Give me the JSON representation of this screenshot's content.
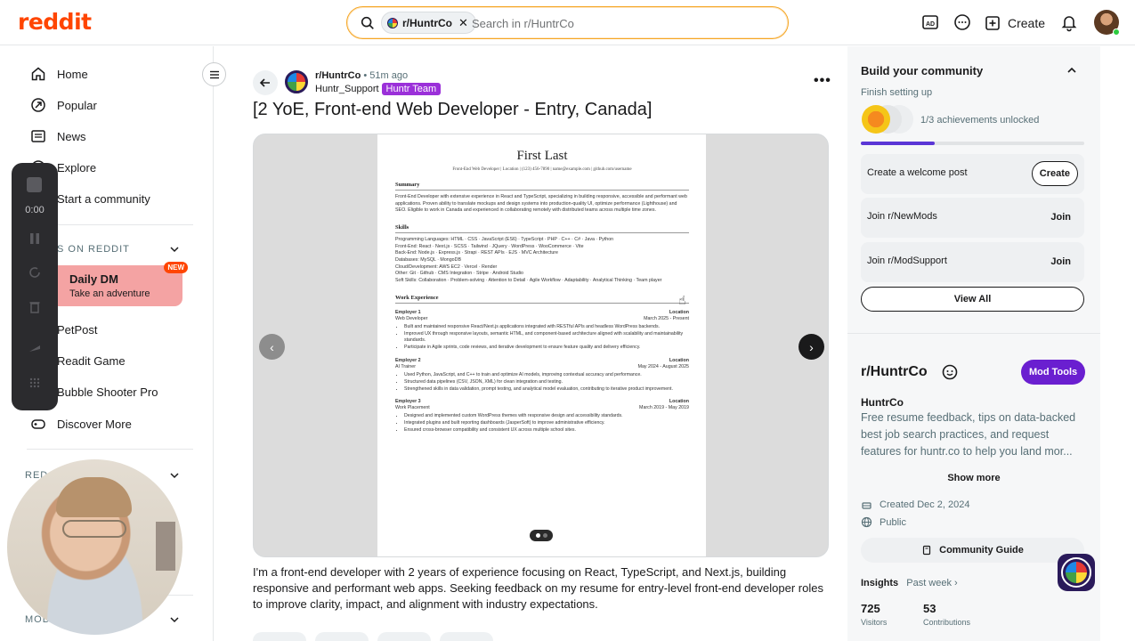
{
  "header": {
    "logo": "reddit",
    "search_chip": "r/HuntrCo",
    "search_placeholder": "Search in r/HuntrCo",
    "create_label": "Create"
  },
  "sidebar": {
    "nav": [
      {
        "label": "Home",
        "icon": "home-icon"
      },
      {
        "label": "Popular",
        "icon": "popular-icon"
      },
      {
        "label": "News",
        "icon": "news-icon"
      },
      {
        "label": "Explore",
        "icon": "explore-icon"
      },
      {
        "label": "Start a community",
        "icon": "plus-icon"
      }
    ],
    "games_label": "S ON REDDIT",
    "daily": {
      "title": "Daily DM",
      "subtitle": "Take an adventure",
      "badge": "NEW"
    },
    "games": [
      "PetPost",
      "Readit Game",
      "Bubble Shooter Pro"
    ],
    "discover": "Discover More",
    "recent_label": "RED",
    "mod_label": "MOD"
  },
  "recorder": {
    "time": "0:00"
  },
  "post": {
    "subreddit": "r/HuntrCo",
    "time_ago": "• 51m ago",
    "author": "Huntr_Support",
    "flair": "Huntr Team",
    "title": "[2 YoE, Front-end Web Developer - Entry, Canada]",
    "body": "I'm a front-end developer with 2 years of experience focusing on React, TypeScript, and Next.js, building responsive and performant web apps. Seeking feedback on my resume for entry-level front-end developer roles to improve clarity, impact, and alignment with industry expectations.",
    "resume": {
      "name": "First Last",
      "contact": "Front-End Web Developer | Location | (123) 456-7890 | name@example.com | github.com/username",
      "summary_h": "Summary",
      "summary": "Front-End Developer with extensive experience in React and TypeScript, specializing in building responsive, accessible and performant web applications. Proven ability to translate mockups and design systems into production-quality UI, optimize performance (Lighthouse) and SEO. Eligible to work in Canada and experienced in collaborating remotely with distributed teams across multiple time zones.",
      "skills_h": "Skills",
      "skills": [
        "Programming Languages: HTML · CSS · JavaScript (ES6) · TypeScript · PHP · C++ · C# · Java · Python",
        "Front-End: React · Next.js · SCSS · Tailwind · JQuery · WordPress · WooCommerce · Vite",
        "Back-End: Node.js · Express.js · Strapi · REST APIs · EJS · MVC Architecture",
        "Databases: MySQL · MongoDB",
        "Cloud/Development: AWS EC2 · Vercel · Render",
        "Other: Git · Github · CMS Integration · Stripe · Android Studio",
        "Soft Skills: Collaboration · Problem-solving · Attention to Detail · Agile Workflow · Adaptability · Analytical Thinking · Team player"
      ],
      "work_h": "Work Experience",
      "jobs": [
        {
          "employer": "Employer 1",
          "loc": "Location",
          "role": "Web Developer",
          "dates": "March 2025 - Present",
          "bullets": [
            "Built and maintained responsive React/Next.js applications integrated with RESTful APIs and headless WordPress backends.",
            "Improved UX through responsive layouts, semantic HTML, and component-based architecture aligned with scalability and maintainability standards.",
            "Participate in Agile sprints, code reviews, and iterative development to ensure feature quality and delivery efficiency."
          ]
        },
        {
          "employer": "Employer 2",
          "loc": "Location",
          "role": "AI Trainer",
          "dates": "May 2024 - August 2025",
          "bullets": [
            "Used Python, JavaScript, and C++ to train and optimize AI models, improving contextual accuracy and performance.",
            "Structured data pipelines (CSV, JSON, XML) for clean integration and testing.",
            "Strengthened skills in data validation, prompt testing, and analytical model evaluation, contributing to iterative product improvement."
          ]
        },
        {
          "employer": "Employer 3",
          "loc": "Location",
          "role": "Work Placement",
          "dates": "March 2019 - May 2019",
          "bullets": [
            "Designed and implemented custom WordPress themes with responsive design and accessibility standards.",
            "Integrated plugins and built reporting dashboards (JasperSoft) to improve administrative efficiency.",
            "Ensured cross-browser compatibility and consistent UX across multiple school sites."
          ]
        }
      ]
    }
  },
  "community_card": {
    "title": "Build your community",
    "subtitle": "Finish setting up",
    "achievements": "1/3 achievements unlocked",
    "progress": 0.33,
    "tasks": [
      {
        "label": "Create a welcome post",
        "action": "Create"
      },
      {
        "label": "Join r/NewMods",
        "action": "Join"
      },
      {
        "label": "Join r/ModSupport",
        "action": "Join"
      }
    ],
    "view_all": "View All"
  },
  "about": {
    "name": "r/HuntrCo",
    "mod_tools": "Mod Tools",
    "title": "HuntrCo",
    "description": "Free resume feedback, tips on data-backed best job search practices, and request features for huntr.co to help you land mor...",
    "show_more": "Show more",
    "created": "Created Dec 2, 2024",
    "visibility": "Public",
    "guide": "Community Guide",
    "insights": "Insights",
    "insights_range": "Past week ›",
    "visitors": "725",
    "visitors_label": "Visitors",
    "contributions": "53",
    "contributions_label": "Contributions"
  }
}
